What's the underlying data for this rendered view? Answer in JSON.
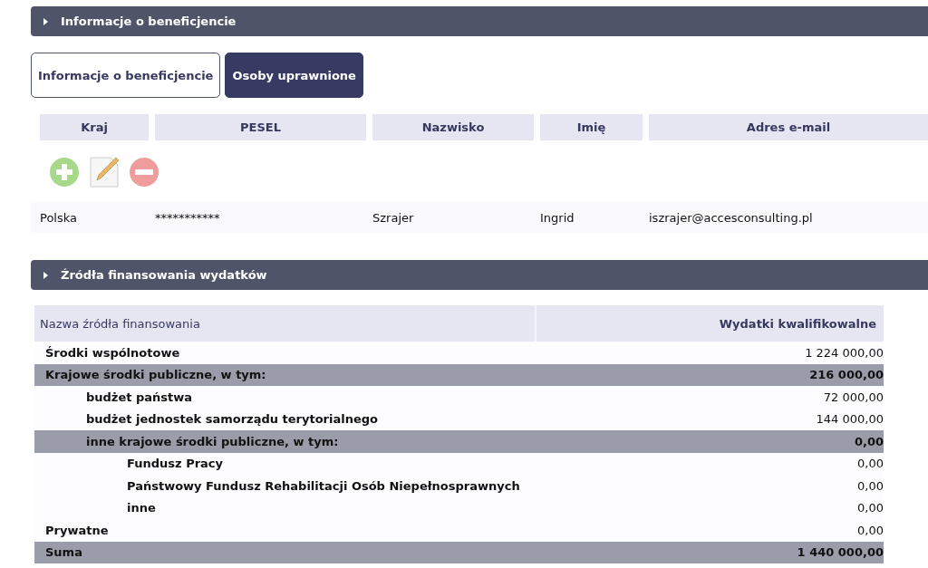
{
  "beneficiary_section": {
    "title": "Informacje o beneficjencie",
    "expanded": false
  },
  "tabs": [
    {
      "label": "Informacje o beneficjencie",
      "selected": false
    },
    {
      "label": "Osoby uprawnione",
      "selected": true
    }
  ],
  "persons_table": {
    "columns": [
      "Kraj",
      "PESEL",
      "Nazwisko",
      "Imię",
      "Adres e-mail"
    ],
    "rows": [
      [
        "Polska",
        "***********",
        "Szrajer",
        "Ingrid",
        "iszrajer@accesconsulting.pl"
      ]
    ]
  },
  "funding_section": {
    "title": "Źródła finansowania wydatków",
    "expanded": false
  },
  "funding_table": {
    "columns": [
      "Nazwa źródła finansowania",
      "Wydatki kwalifikowalne"
    ],
    "rows": [
      {
        "name": "Środki wspólnotowe",
        "value": "1 224 000,00",
        "kind": "item"
      },
      {
        "name": "Krajowe środki publiczne, w tym:",
        "value": "216 000,00",
        "kind": "subtotal",
        "children": [
          {
            "name": "budżet państwa",
            "value": "72 000,00",
            "kind": "item"
          },
          {
            "name": "budżet jednostek samorządu terytorialnego",
            "value": "144 000,00",
            "kind": "item"
          },
          {
            "name": "inne krajowe środki publiczne, w tym:",
            "value": "0,00",
            "kind": "subtotal",
            "children": [
              {
                "name": "Fundusz Pracy",
                "value": "0,00",
                "kind": "item"
              },
              {
                "name": "Państwowy Fundusz Rehabilitacji Osób Niepełnosprawnych",
                "value": "0,00",
                "kind": "item"
              },
              {
                "name": "inne",
                "value": "0,00",
                "kind": "item"
              }
            ]
          }
        ]
      },
      {
        "name": "Prywatne",
        "value": "0,00",
        "kind": "item"
      },
      {
        "name": "Suma",
        "value": "1 440 000,00",
        "kind": "subtotal"
      }
    ]
  }
}
